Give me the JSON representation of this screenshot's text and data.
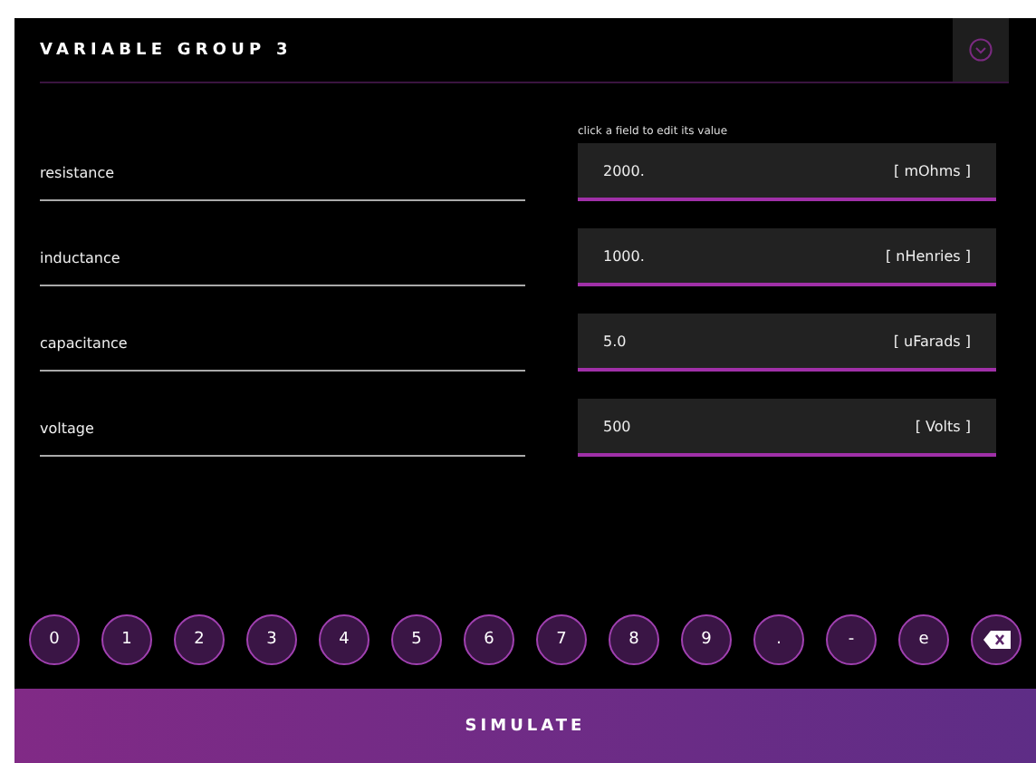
{
  "header": {
    "title": "VARIABLE GROUP 3"
  },
  "hint": "click a field to edit its value",
  "variables": [
    {
      "name": "resistance",
      "value": "2000.",
      "unit": "[ mOhms ]"
    },
    {
      "name": "inductance",
      "value": "1000.",
      "unit": "[ nHenries ]"
    },
    {
      "name": "capacitance",
      "value": "5.0",
      "unit": "[ uFarads ]"
    },
    {
      "name": "voltage",
      "value": "500",
      "unit": "[ Volts ]"
    }
  ],
  "keypad": [
    {
      "kind": "text",
      "label": "0"
    },
    {
      "kind": "text",
      "label": "1"
    },
    {
      "kind": "text",
      "label": "2"
    },
    {
      "kind": "text",
      "label": "3"
    },
    {
      "kind": "text",
      "label": "4"
    },
    {
      "kind": "text",
      "label": "5"
    },
    {
      "kind": "text",
      "label": "6"
    },
    {
      "kind": "text",
      "label": "7"
    },
    {
      "kind": "text",
      "label": "8"
    },
    {
      "kind": "text",
      "label": "9"
    },
    {
      "kind": "text",
      "label": "."
    },
    {
      "kind": "text",
      "label": "-"
    },
    {
      "kind": "text",
      "label": "e"
    },
    {
      "kind": "backspace"
    }
  ],
  "simulate_button": "SIMULATE"
}
